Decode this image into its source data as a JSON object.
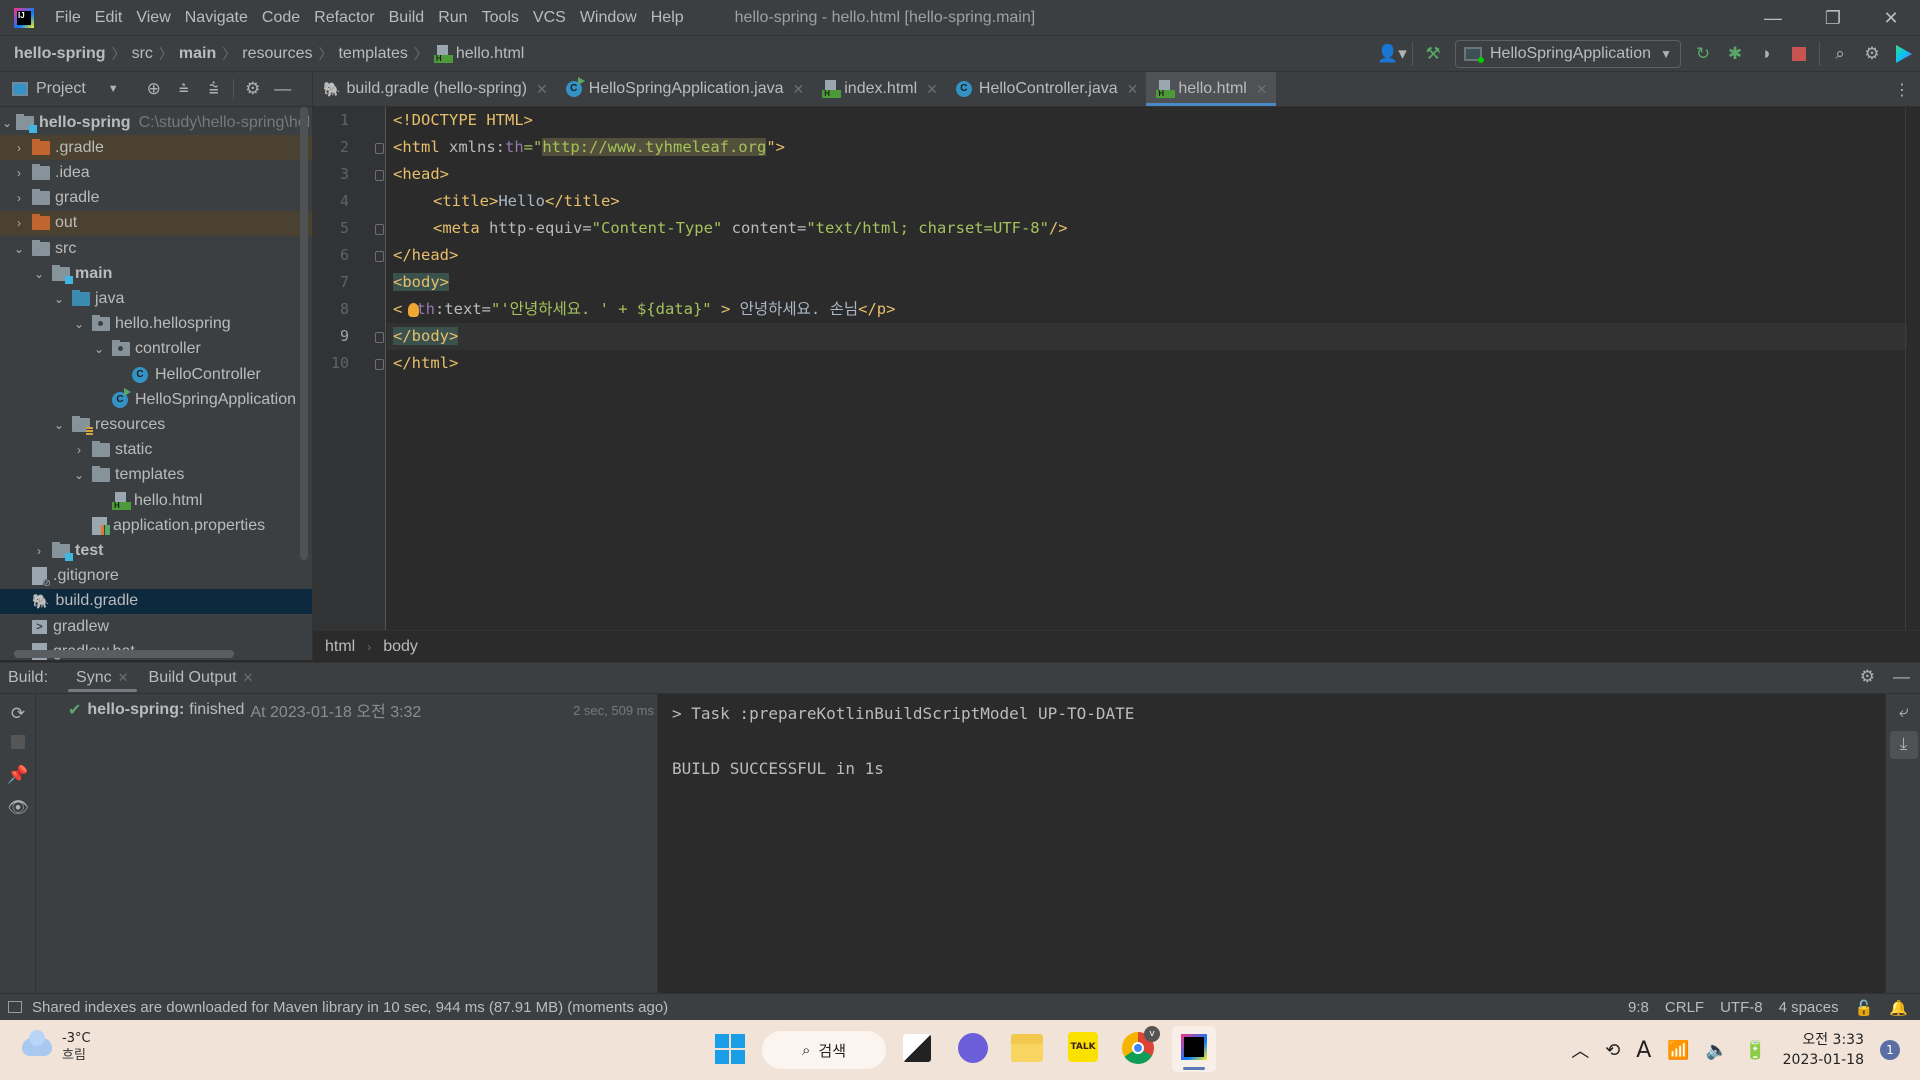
{
  "window": {
    "title": "hello-spring - hello.html [hello-spring.main]",
    "menu": [
      "File",
      "Edit",
      "View",
      "Navigate",
      "Code",
      "Refactor",
      "Build",
      "Run",
      "Tools",
      "VCS",
      "Window",
      "Help"
    ],
    "controls": {
      "minimize": "—",
      "restore": "❐",
      "close": "✕"
    }
  },
  "navbar": {
    "breadcrumb": [
      "hello-spring",
      "src",
      "main",
      "resources",
      "templates",
      "hello.html"
    ],
    "run_config": "HelloSpringApplication",
    "toolbar_icons": [
      "user-icon",
      "build-hammer-icon",
      "rerun-icon",
      "debug-icon",
      "coverage-icon",
      "stop-icon",
      "search-icon",
      "settings-icon",
      "toolbox-icon"
    ]
  },
  "project_panel": {
    "title": "Project",
    "root_name": "hello-spring",
    "root_path": "C:\\study\\hello-spring\\hel",
    "tree": [
      {
        "label": ".gradle",
        "type": "folder-excluded",
        "depth": 0,
        "arrow": "›"
      },
      {
        "label": ".idea",
        "type": "folder",
        "depth": 0,
        "arrow": "›"
      },
      {
        "label": "gradle",
        "type": "folder",
        "depth": 0,
        "arrow": "›"
      },
      {
        "label": "out",
        "type": "folder-excluded",
        "depth": 0,
        "arrow": "›"
      },
      {
        "label": "src",
        "type": "folder",
        "depth": 0,
        "arrow": "⌄"
      },
      {
        "label": "main",
        "type": "module",
        "depth": 1,
        "arrow": "⌄"
      },
      {
        "label": "java",
        "type": "source",
        "depth": 2,
        "arrow": "⌄"
      },
      {
        "label": "hello.hellospring",
        "type": "package",
        "depth": 3,
        "arrow": "⌄"
      },
      {
        "label": "controller",
        "type": "package",
        "depth": 4,
        "arrow": "⌄"
      },
      {
        "label": "HelloController",
        "type": "class",
        "depth": 5,
        "arrow": ""
      },
      {
        "label": "HelloSpringApplication",
        "type": "spring-class",
        "depth": 4,
        "arrow": ""
      },
      {
        "label": "resources",
        "type": "resources",
        "depth": 2,
        "arrow": "⌄"
      },
      {
        "label": "static",
        "type": "folder",
        "depth": 3,
        "arrow": "›"
      },
      {
        "label": "templates",
        "type": "folder",
        "depth": 3,
        "arrow": "⌄"
      },
      {
        "label": "hello.html",
        "type": "html",
        "depth": 4,
        "arrow": ""
      },
      {
        "label": "application.properties",
        "type": "properties",
        "depth": 3,
        "arrow": ""
      },
      {
        "label": "test",
        "type": "module",
        "depth": 1,
        "arrow": "›"
      },
      {
        "label": ".gitignore",
        "type": "gitignore",
        "depth": 0,
        "arrow": ""
      },
      {
        "label": "build.gradle",
        "type": "gradle",
        "depth": 0,
        "arrow": "",
        "selected": true
      },
      {
        "label": "gradlew",
        "type": "terminal",
        "depth": 0,
        "arrow": ""
      },
      {
        "label": "gradlew.bat",
        "type": "file",
        "depth": 0,
        "arrow": ""
      }
    ]
  },
  "tabs": [
    {
      "label": "build.gradle (hello-spring)",
      "icon": "gradle-icon",
      "active": false
    },
    {
      "label": "HelloSpringApplication.java",
      "icon": "spring-class-icon",
      "active": false
    },
    {
      "label": "index.html",
      "icon": "html-file-icon",
      "active": false
    },
    {
      "label": "HelloController.java",
      "icon": "class-icon",
      "active": false
    },
    {
      "label": "hello.html",
      "icon": "html-file-icon",
      "active": true
    }
  ],
  "editor": {
    "current_line": 9,
    "warnings": "1",
    "lines": [
      "1",
      "2",
      "3",
      "4",
      "5",
      "6",
      "7",
      "8",
      "9",
      "10"
    ],
    "code": {
      "l1": "<!DOCTYPE HTML>",
      "l2_open": "<html ",
      "l2_attr": "xmlns:",
      "l2_ns": "th",
      "l2_eq": "=\"",
      "l2_url": "http://www.tyhmeleaf.org",
      "l2_close": "\">",
      "l3": "<head>",
      "l4_open": "<title>",
      "l4_text": "Hello",
      "l4_close": "</title>",
      "l5_open": "<meta ",
      "l5_attr1": "http-equiv=",
      "l5_val1": "\"Content-Type\"",
      "l5_attr2": " content=",
      "l5_val2": "\"text/html; charset=UTF-8\"",
      "l5_close": "/>",
      "l6": "</head>",
      "l7": "<body>",
      "l8_open": "<",
      "l8_ns": "th",
      "l8_attr": ":text=",
      "l8_val": "\"'안녕하세요. ' + ${data}\"",
      "l8_gt": " > ",
      "l8_text": "안녕하세요. 손님",
      "l8_close": "</p>",
      "l9": "</body>",
      "l10": "</html>"
    },
    "breadcrumb": [
      "html",
      "body"
    ]
  },
  "build_panel": {
    "label": "Build:",
    "tabs": [
      {
        "label": "Sync",
        "active": true
      },
      {
        "label": "Build Output",
        "active": false
      }
    ],
    "result": {
      "project": "hello-spring:",
      "status": "finished",
      "when": "At 2023-01-18 오전 3:32",
      "duration": "2 sec, 509 ms"
    },
    "console": [
      "> Task :prepareKotlinBuildScriptModel UP-TO-DATE",
      "",
      "BUILD SUCCESSFUL in 1s"
    ]
  },
  "statusbar": {
    "message": "Shared indexes are downloaded for Maven library in 10 sec, 944 ms (87.91 MB) (moments ago)",
    "position": "9:8",
    "line_sep": "CRLF",
    "encoding": "UTF-8",
    "indent": "4 spaces"
  },
  "taskbar": {
    "weather_temp": "-3°C",
    "weather_desc": "흐림",
    "search_label": "검색",
    "ime": "A",
    "time": "오전 3:33",
    "date": "2023-01-18",
    "notifications": "1",
    "chrome_badge": "v"
  },
  "colors": {
    "accent": "#4a88c7",
    "success": "#59a869",
    "stop": "#c75450",
    "warning": "#e3b341"
  }
}
